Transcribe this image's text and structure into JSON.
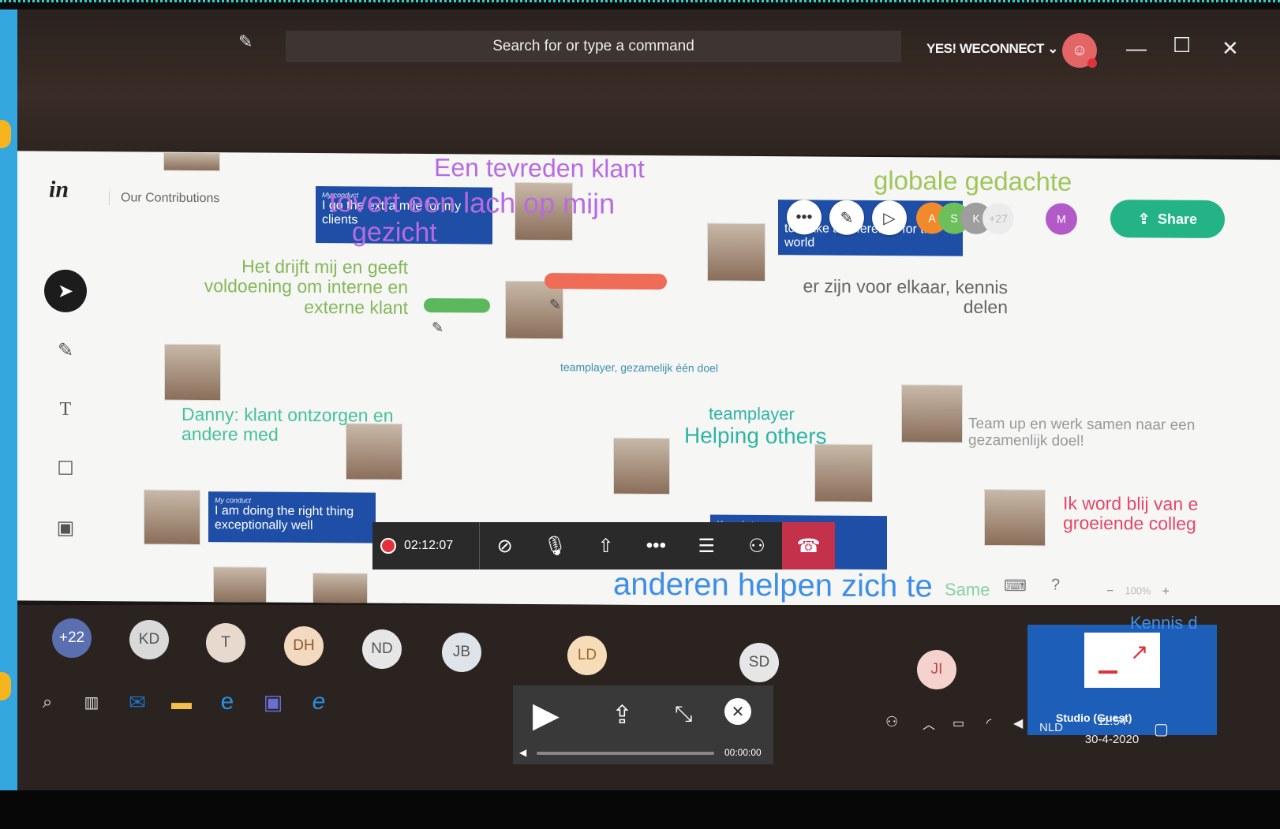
{
  "teams": {
    "search_placeholder": "Search for or type a command",
    "tenant": "YES! WECONNECT",
    "tenant_chevron": "⌄",
    "win_min": "—",
    "win_max": "☐",
    "win_close": "✕"
  },
  "invision": {
    "logo": "in",
    "board_title": "Our Contributions",
    "share_label": "Share",
    "collab_extra": "+27",
    "collab_avatars": [
      {
        "initial": "A",
        "color": "#f08a2a"
      },
      {
        "initial": "S",
        "color": "#6cbf5a"
      },
      {
        "initial": "K",
        "color": "#9e9e9e"
      },
      {
        "initial": "M",
        "color": "#b25ac7"
      }
    ],
    "zoom_minus": "−",
    "zoom_level": "100%",
    "zoom_plus": "+"
  },
  "board_notes": {
    "n1": "Een tevreden klant",
    "n2": "tovert een lach op mijn",
    "n3": "gezicht",
    "n4": "Het drijft mij en geeft voldoening om interne en externe klant",
    "n5": "er zijn voor elkaar, kennis delen",
    "n6": "globale gedachte",
    "n7": "teamplayer, gezamelijk één doel",
    "n8": "Danny: klant ontzorgen en andere med",
    "n9": "teamplayer",
    "n10": "Helping others",
    "n11": "Team up en werk samen naar een gezamenlijk doel!",
    "n12": "Ik word blij van e groeiende colleg",
    "n13": "anderen helpen zich te",
    "n14": "Same",
    "n15": "Kennis d"
  },
  "cards": {
    "c1_tag": "My conduct",
    "c1_text": "I go the extra mile for my clients",
    "c2_tag": "My conduct",
    "c2_text": "I am doing the right thing exceptionally well",
    "c3_text": "to make a difference for the world",
    "c4_tag": "My conduct"
  },
  "call": {
    "timer": "02:12:07"
  },
  "participants": [
    {
      "initials": "+22",
      "bg": "#5a6fb0",
      "fg": "#ffffff"
    },
    {
      "initials": "KD",
      "bg": "#d9d9d9",
      "fg": "#555555"
    },
    {
      "initials": "T",
      "bg": "#e8d9cf",
      "fg": "#555555"
    },
    {
      "initials": "DH",
      "bg": "#f3d9c0",
      "fg": "#8a5a2a"
    },
    {
      "initials": "ND",
      "bg": "#e6e6e6",
      "fg": "#555555"
    },
    {
      "initials": "JB",
      "bg": "#dfe4ea",
      "fg": "#555555"
    },
    {
      "initials": "LD",
      "bg": "#f6dcb8",
      "fg": "#9b6a2a"
    },
    {
      "initials": "SD",
      "bg": "#e6e6e6",
      "fg": "#555555"
    },
    {
      "initials": "JI",
      "bg": "#f6d2cf",
      "fg": "#b5443a"
    }
  ],
  "player": {
    "time": "00:00:00"
  },
  "studio": {
    "label": "Studio (Guest)"
  },
  "tray": {
    "lang": "NLD",
    "time": "11:54",
    "date": "30-4-2020"
  }
}
